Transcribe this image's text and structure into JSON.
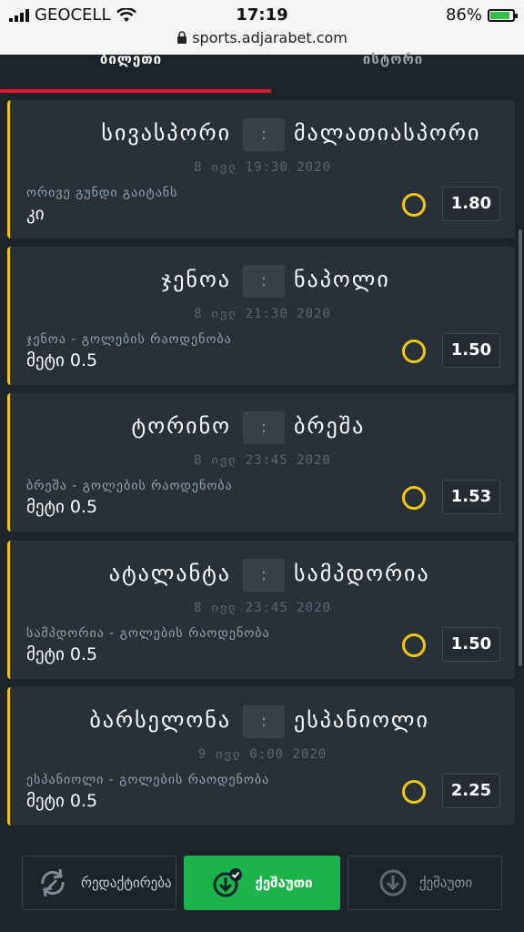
{
  "status": {
    "carrier": "GEOCELL",
    "time": "17:19",
    "battery": "86%",
    "battery_level": 0.86,
    "url": "sports.adjarabet.com"
  },
  "tabs": [
    {
      "label": "ბილეთი"
    },
    {
      "label": "ისტორი"
    }
  ],
  "bets": [
    {
      "home": "სივასპორი",
      "away": "მალათიასპორი",
      "vs": ":",
      "date": "8 ივლ 19:30 2020",
      "market": "ორივე გუნდი გაიტანს",
      "selection": "კი",
      "odds": "1.80"
    },
    {
      "home": "ჯენოა",
      "away": "ნაპოლი",
      "vs": ":",
      "date": "8 ივლ 21:30 2020",
      "market": "ჯენოა - გოლების რაოდენობა",
      "selection": "მეტი 0.5",
      "odds": "1.50"
    },
    {
      "home": "ტორინო",
      "away": "ბრეშა",
      "vs": ":",
      "date": "8 ივლ 23:45 2020",
      "market": "ბრეშა - გოლების რაოდენობა",
      "selection": "მეტი 0.5",
      "odds": "1.53"
    },
    {
      "home": "ატალანტა",
      "away": "სამპდორია",
      "vs": ":",
      "date": "8 ივლ 23:45 2020",
      "market": "სამპდორია - გოლების რაოდენობა",
      "selection": "მეტი 0.5",
      "odds": "1.50"
    },
    {
      "home": "ბარსელონა",
      "away": "ესპანიოლი",
      "vs": ":",
      "date": "9 ივლ 0:00 2020",
      "market": "ესპანიოლი - გოლების რაოდენობა",
      "selection": "მეტი 0.5",
      "odds": "2.25"
    }
  ],
  "actions": {
    "edit_label": "რედაქტირება",
    "save_label": "ქეშაუთი",
    "save2_label": "ქეშაუთი"
  },
  "colors": {
    "accent_yellow": "#f2c811",
    "tab_active": "#e0182f",
    "save_green": "#1cb34a"
  }
}
